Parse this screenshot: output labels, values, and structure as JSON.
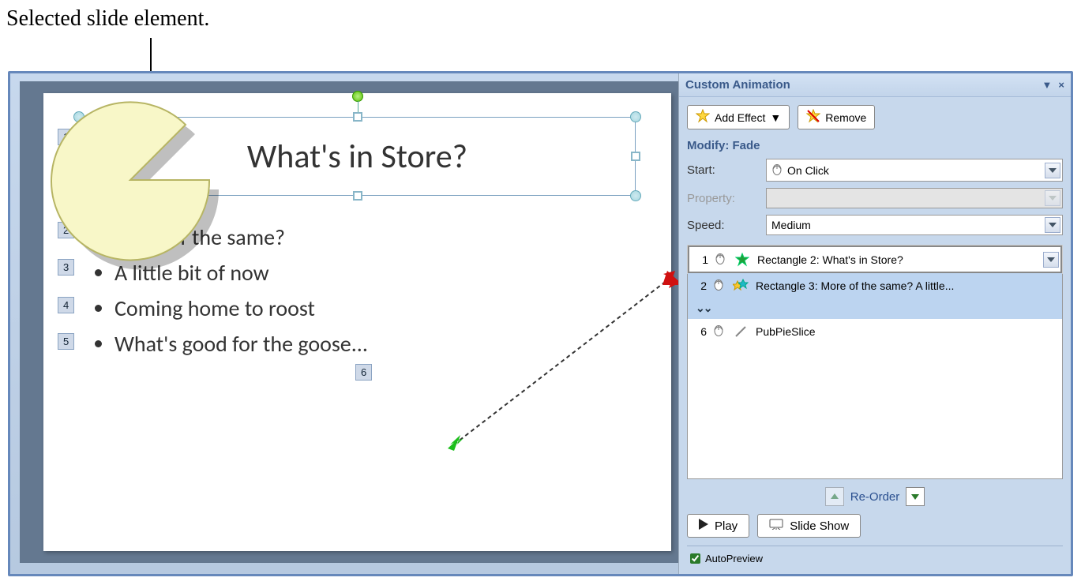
{
  "caption": "Selected slide element.",
  "slide": {
    "title": "What's in Store?",
    "bullets": [
      "More of the same?",
      "A little bit of now",
      "Coming home to roost",
      "What's good for the goose..."
    ],
    "tags": {
      "t1": "1",
      "t2": "2",
      "t3": "3",
      "t4": "4",
      "t5": "5",
      "t6": "6"
    }
  },
  "pane": {
    "title": "Custom Animation",
    "buttons": {
      "add_effect": "Add Effect",
      "remove": "Remove"
    },
    "modify_label": "Modify: Fade",
    "form": {
      "start_label": "Start:",
      "start_value": "On Click",
      "property_label": "Property:",
      "property_value": "",
      "speed_label": "Speed:",
      "speed_value": "Medium"
    },
    "anim_items": [
      {
        "num": "1",
        "label": "Rectangle 2: What's in Store?"
      },
      {
        "num": "2",
        "label": "Rectangle 3: More of the same? A little..."
      },
      {
        "num": "6",
        "label": "PubPieSlice"
      }
    ],
    "reorder_label": "Re-Order",
    "play_label": "Play",
    "slideshow_label": "Slide Show",
    "autopreview_label": "AutoPreview"
  }
}
